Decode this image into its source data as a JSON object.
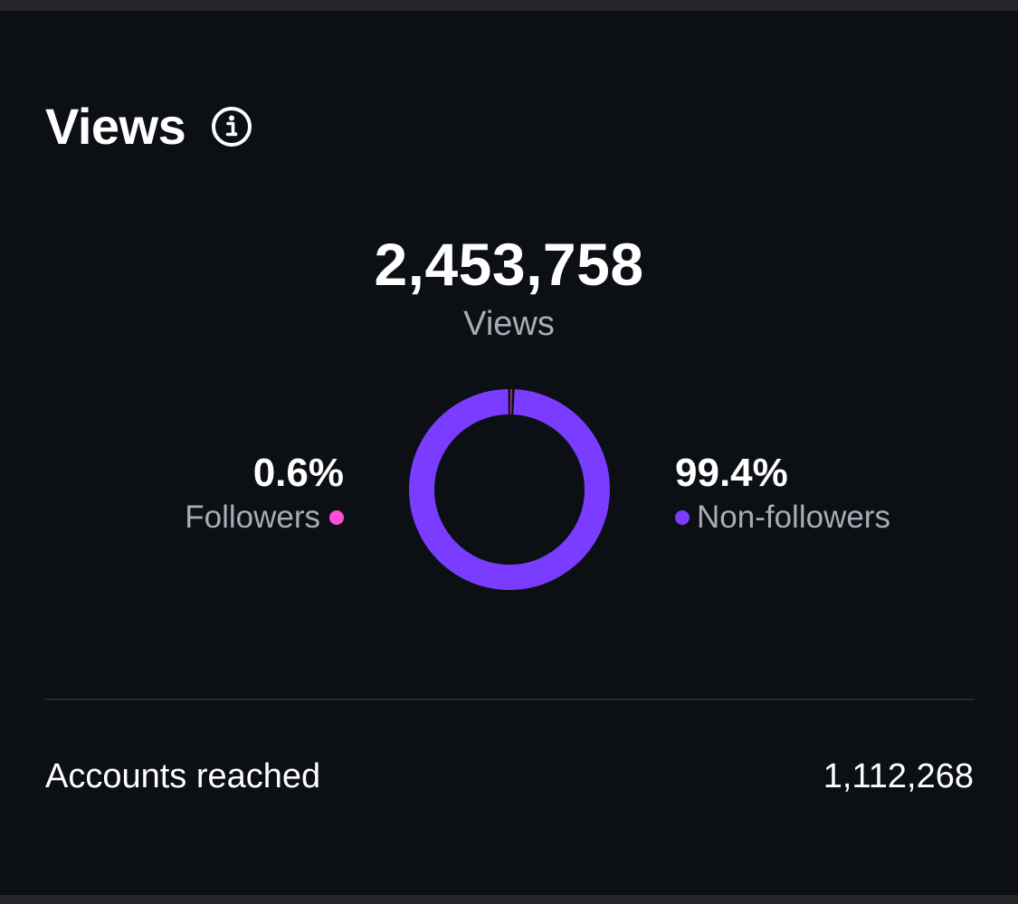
{
  "header": {
    "title": "Views",
    "info_icon": "info-icon"
  },
  "summary": {
    "total_value": "2,453,758",
    "total_label": "Views"
  },
  "breakdown": {
    "followers": {
      "percent_label": "0.6%",
      "label": "Followers",
      "color": "#ff4fd8",
      "share": 0.006
    },
    "non_followers": {
      "percent_label": "99.4%",
      "label": "Non-followers",
      "color": "#7a3cff",
      "share": 0.994
    }
  },
  "metrics": [
    {
      "label": "Accounts reached",
      "value": "1,112,268"
    }
  ],
  "colors": {
    "background": "#0c0f14",
    "text_primary": "#ffffff",
    "text_secondary": "#a8adb5",
    "divider": "#25282d"
  }
}
